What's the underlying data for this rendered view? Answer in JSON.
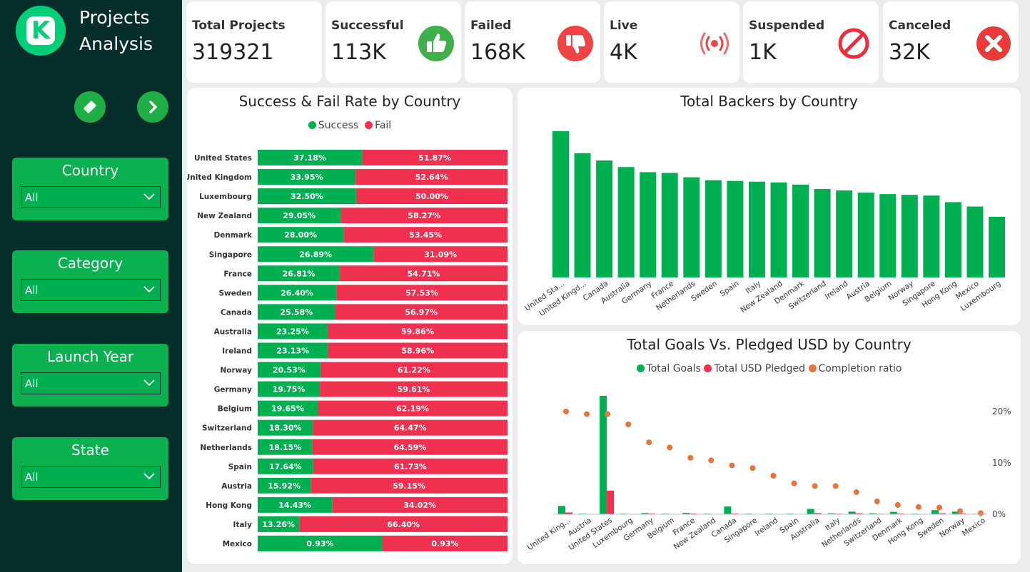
{
  "app": {
    "title_line1": "Projects",
    "title_line2": "Analysis"
  },
  "colors": {
    "success": "#00b050",
    "fail": "#f0304f",
    "ratio": "#e8743b",
    "sidebar": "#062f2b"
  },
  "toolbar": {
    "clear_icon": "eraser-icon",
    "next_icon": "chevron-right-icon"
  },
  "slicers": [
    {
      "label": "Country",
      "value": "All"
    },
    {
      "label": "Category",
      "value": "All"
    },
    {
      "label": "Launch Year",
      "value": "All"
    },
    {
      "label": "State",
      "value": "All"
    }
  ],
  "kpis": [
    {
      "label": "Total Projects",
      "value": "319321",
      "icon": ""
    },
    {
      "label": "Successful",
      "value": "113K",
      "icon": "thumbs-up-icon"
    },
    {
      "label": "Failed",
      "value": "168K",
      "icon": "thumbs-down-icon"
    },
    {
      "label": "Live",
      "value": "4K",
      "icon": "live-broadcast-icon"
    },
    {
      "label": "Suspended",
      "value": "1K",
      "icon": "prohibited-icon"
    },
    {
      "label": "Canceled",
      "value": "32K",
      "icon": "cancel-x-icon"
    }
  ],
  "chart_data": [
    {
      "type": "bar",
      "orientation": "horizontal",
      "stacked": true,
      "title": "Success & Fail Rate by Country",
      "legend": [
        "Success",
        "Fail"
      ],
      "legend_position": "top-center",
      "categories": [
        "United States",
        "United Kingdom",
        "Luxembourg",
        "New Zealand",
        "Denmark",
        "Singapore",
        "France",
        "Sweden",
        "Canada",
        "Australia",
        "Ireland",
        "Norway",
        "Germany",
        "Belgium",
        "Switzerland",
        "Netherlands",
        "Spain",
        "Austria",
        "Hong Kong",
        "Italy",
        "Mexico"
      ],
      "series": [
        {
          "name": "Success",
          "values": [
            37.18,
            33.95,
            32.5,
            29.05,
            28.0,
            26.89,
            26.81,
            26.4,
            25.58,
            23.25,
            23.13,
            20.53,
            19.75,
            19.65,
            18.3,
            18.15,
            17.64,
            15.92,
            14.43,
            13.26,
            0.93
          ],
          "labels": [
            "37.18%",
            "33.95%",
            "32.50%",
            "29.05%",
            "28.00%",
            "26.89%",
            "26.81%",
            "26.40%",
            "25.58%",
            "23.25%",
            "23.13%",
            "20.53%",
            "19.75%",
            "19.65%",
            "18.30%",
            "18.15%",
            "17.64%",
            "15.92%",
            "14.43%",
            "13.26%",
            "0.93%"
          ]
        },
        {
          "name": "Fail",
          "values": [
            51.87,
            52.64,
            50.0,
            58.27,
            53.45,
            31.09,
            54.71,
            57.53,
            56.97,
            59.86,
            58.96,
            61.22,
            59.61,
            62.19,
            64.47,
            64.59,
            61.73,
            59.15,
            34.02,
            66.4,
            0.93
          ],
          "labels": [
            "51.87%",
            "52.64%",
            "50.00%",
            "58.27%",
            "53.45%",
            "31.09%",
            "54.71%",
            "57.53%",
            "56.97%",
            "59.86%",
            "58.96%",
            "61.22%",
            "59.61%",
            "62.19%",
            "64.47%",
            "64.59%",
            "61.73%",
            "59.15%",
            "34.02%",
            "66.40%",
            "0.93%"
          ]
        }
      ],
      "normalized_to_100pct": true
    },
    {
      "type": "bar",
      "title": "Total Backers by Country",
      "categories": [
        "United Sta...",
        "United Kingd...",
        "Canada",
        "Australia",
        "Germany",
        "France",
        "Netherlands",
        "Sweden",
        "Spain",
        "Italy",
        "New Zealand",
        "Denmark",
        "Switzerland",
        "Ireland",
        "Austria",
        "Belgium",
        "Norway",
        "Singapore",
        "Hong Kong",
        "Mexico",
        "Luxembourg"
      ],
      "values": [
        100,
        85,
        80,
        75.5,
        72,
        71.5,
        68.5,
        66.5,
        66,
        65.5,
        65,
        63.5,
        60.5,
        59.5,
        58,
        57,
        56.5,
        56,
        51.5,
        48.5,
        41.5
      ],
      "values_scale": "relative, no y-axis shown",
      "ylim": [
        0,
        100
      ],
      "grid": false
    },
    {
      "type": "bar+scatter",
      "title": "Total Goals Vs. Pledged USD by Country",
      "legend": [
        "Total Goals",
        "Total USD Pledged",
        "Completion ratio"
      ],
      "legend_position": "top-center",
      "categories": [
        "United King...",
        "Austria",
        "United States",
        "Luxembourg",
        "Germany",
        "Belgium",
        "France",
        "New Zealand",
        "Canada",
        "Singapore",
        "Ireland",
        "Spain",
        "Australia",
        "Italy",
        "Netherlands",
        "Switzerland",
        "Denmark",
        "Hong Kong",
        "Sweden",
        "Norway",
        "Mexico"
      ],
      "series": [
        {
          "name": "Total Goals",
          "values": [
            7,
            0.5,
            100,
            0.5,
            1,
            0.5,
            1.2,
            0.5,
            6.5,
            0.5,
            0.5,
            0.5,
            4.5,
            0.8,
            2.2,
            0.8,
            2,
            0.5,
            3.5,
            2.2,
            0.4
          ]
        },
        {
          "name": "Total USD Pledged",
          "values": [
            1.5,
            0.3,
            20,
            0.3,
            0.6,
            0.3,
            0.6,
            0.3,
            0.6,
            0.3,
            0.3,
            0.3,
            1,
            0.5,
            0.8,
            0.4,
            0.6,
            0.3,
            0.8,
            0.6,
            0.2
          ]
        },
        {
          "name": "Completion ratio",
          "values": [
            20,
            19.5,
            19.5,
            17.5,
            14,
            13,
            11,
            10.5,
            9.5,
            9,
            7.5,
            6,
            5.5,
            5.5,
            4.3,
            2.5,
            1.8,
            1.4,
            1.3,
            0.6,
            0.2
          ]
        }
      ],
      "y2_ticks": [
        "20%",
        "10%",
        "0%"
      ],
      "y2lim": [
        0,
        20
      ]
    }
  ]
}
